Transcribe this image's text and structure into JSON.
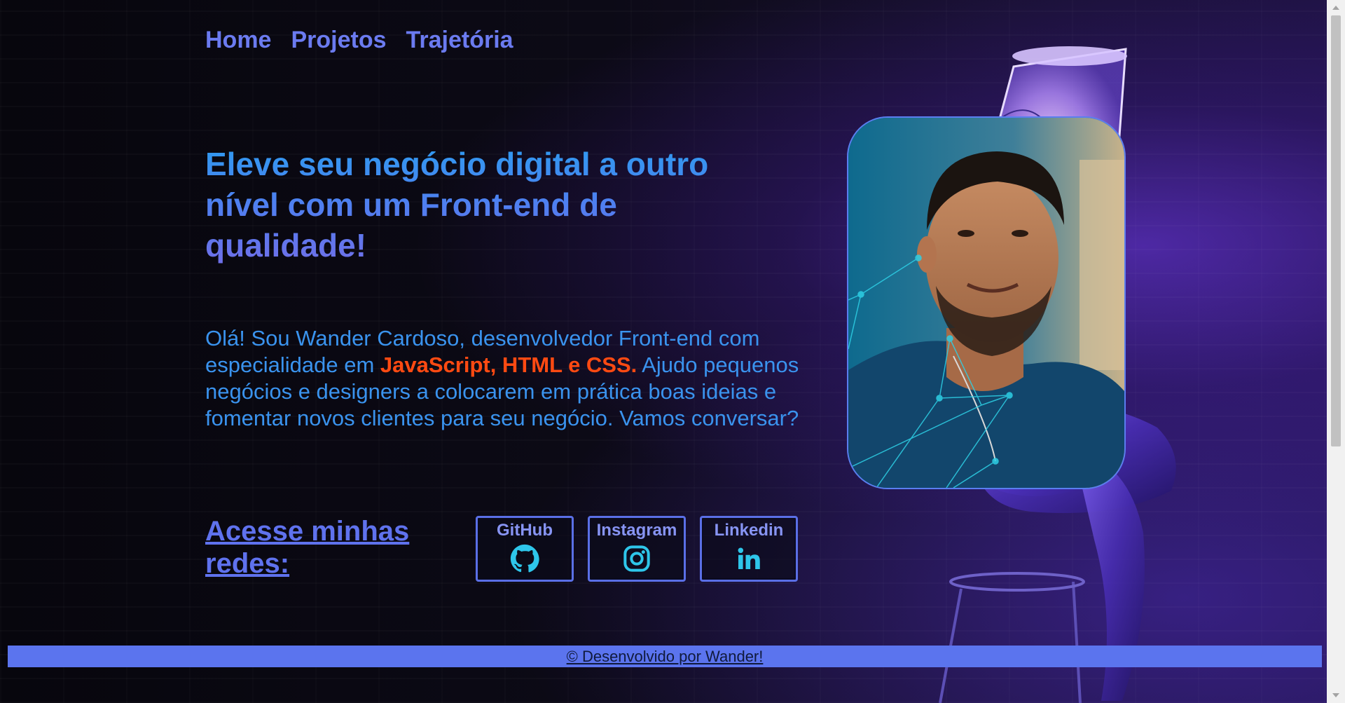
{
  "nav": {
    "items": [
      {
        "label": "Home"
      },
      {
        "label": "Projetos"
      },
      {
        "label": "Trajetória"
      }
    ]
  },
  "hero": {
    "headline": "Eleve seu negócio digital a outro nível com um Front-end de qualidade!",
    "intro_before": "Olá! Sou Wander Cardoso, desenvolvedor Front-end com especialidade em ",
    "intro_highlight": "JavaScript, HTML e CSS.",
    "intro_after": " Ajudo pequenos negócios e designers a colocarem em prática boas ideias e fomentar novos clientes para seu negócio. Vamos conversar?"
  },
  "social": {
    "title": "Acesse minhas redes:",
    "buttons": [
      {
        "label": "GitHub",
        "icon": "github-icon"
      },
      {
        "label": "Instagram",
        "icon": "instagram-icon"
      },
      {
        "label": "Linkedin",
        "icon": "linkedin-icon"
      }
    ]
  },
  "footer": {
    "text": "© Desenvolvido por Wander!"
  },
  "colors": {
    "accent": "#5b74ee",
    "headline": "#2e9bf0",
    "highlight": "#ff4a12",
    "icon": "#2ec6ea"
  }
}
